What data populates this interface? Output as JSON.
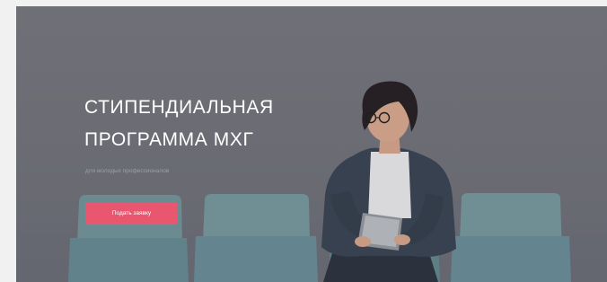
{
  "hero": {
    "title_line1": "СТИПЕНДИАЛЬНАЯ",
    "title_line2": "ПРОГРАММА МХГ",
    "subtitle": "для молодых профессионалов",
    "cta_label": "Подать заявку"
  },
  "colors": {
    "accent": "#e8566f",
    "wall": "#6f7077",
    "chair": "#6e8e92",
    "jacket": "#36404e"
  }
}
